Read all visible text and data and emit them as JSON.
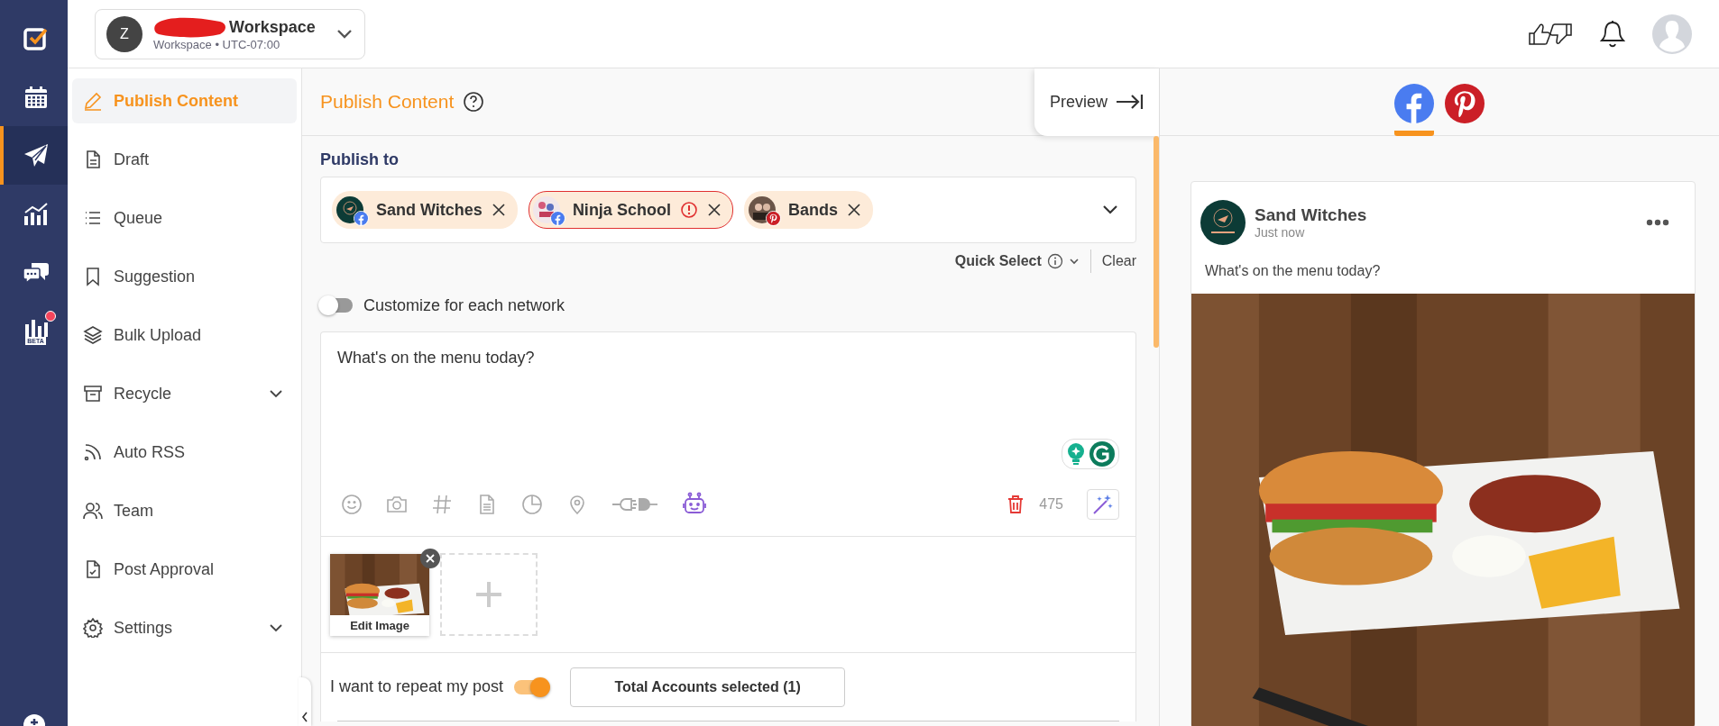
{
  "rail": {
    "items": [
      {
        "selected": false
      },
      {
        "selected": false
      },
      {
        "selected": true
      },
      {
        "selected": false
      },
      {
        "selected": false
      },
      {
        "selected": false,
        "badge_text": "BETA",
        "dot": true
      }
    ]
  },
  "topbar": {
    "workspace": {
      "initial": "Z",
      "name": "Workspace",
      "subtitle": "Workspace • UTC-07:00"
    }
  },
  "sidebar": {
    "items": [
      {
        "label": "Publish Content",
        "selected": true,
        "kind": "link"
      },
      {
        "label": "Draft",
        "selected": false,
        "kind": "link"
      },
      {
        "label": "Queue",
        "selected": false,
        "kind": "link"
      },
      {
        "label": "Suggestion",
        "selected": false,
        "kind": "link"
      },
      {
        "label": "Bulk Upload",
        "selected": false,
        "kind": "link"
      },
      {
        "label": "Recycle",
        "selected": false,
        "kind": "menu",
        "expanded": false
      },
      {
        "label": "Auto RSS",
        "selected": false,
        "kind": "link"
      },
      {
        "label": "Team",
        "selected": false,
        "kind": "link"
      },
      {
        "label": "Post Approval",
        "selected": false,
        "kind": "link"
      },
      {
        "label": "Settings",
        "selected": false,
        "kind": "menu",
        "expanded": false
      }
    ]
  },
  "composer": {
    "title": "Publish Content",
    "preview_button": "Preview",
    "publish_to": "Publish to",
    "accounts": [
      {
        "name": "Sand Witches",
        "kind": "facebook",
        "error": false
      },
      {
        "name": "Ninja School",
        "kind": "facebook",
        "error": true
      },
      {
        "name": "Bands",
        "kind": "pinterest",
        "error": false
      }
    ],
    "quick_select": "Quick Select",
    "clear": "Clear",
    "customize": {
      "label": "Customize for each network",
      "on": false
    },
    "text": "What's on the menu today?",
    "char_count": "475",
    "media": {
      "edit_label": "Edit Image"
    },
    "repeat": {
      "label": "I want to repeat my post",
      "on": true
    },
    "accounts_button": "Total Accounts selected (1)"
  },
  "preview": {
    "tabs": [
      {
        "kind": "facebook",
        "selected": true
      },
      {
        "kind": "pinterest",
        "selected": false
      }
    ],
    "post": {
      "author": "Sand Witches",
      "time": "Just now",
      "text": "What's on the menu today?"
    }
  }
}
